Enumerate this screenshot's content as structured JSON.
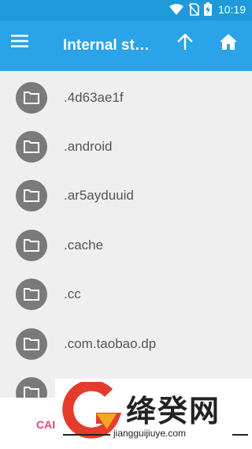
{
  "status": {
    "time": "10:19",
    "icons": [
      "wifi-icon",
      "no-sim-icon",
      "battery-charging-icon"
    ]
  },
  "toolbar": {
    "title": "Internal storage",
    "menu_icon": "hamburger-menu-icon",
    "up_icon": "arrow-up-icon",
    "home_icon": "home-icon"
  },
  "files": [
    {
      "name": ".4d63ae1f"
    },
    {
      "name": ".android"
    },
    {
      "name": ".ar5ayduuid"
    },
    {
      "name": ".cache"
    },
    {
      "name": ".cc"
    },
    {
      "name": ".com.taobao.dp"
    },
    {
      "name": ""
    }
  ],
  "footer": {
    "cancel_label": "CAI"
  },
  "watermark": {
    "brand": "绛癸网",
    "url": "jiangguijiuye.com"
  },
  "colors": {
    "status_bar": "#1e9ad8",
    "toolbar": "#2aa3e8",
    "folder_circle": "#7a7a7a",
    "list_bg": "#efefef",
    "accent": "#e0457a"
  }
}
